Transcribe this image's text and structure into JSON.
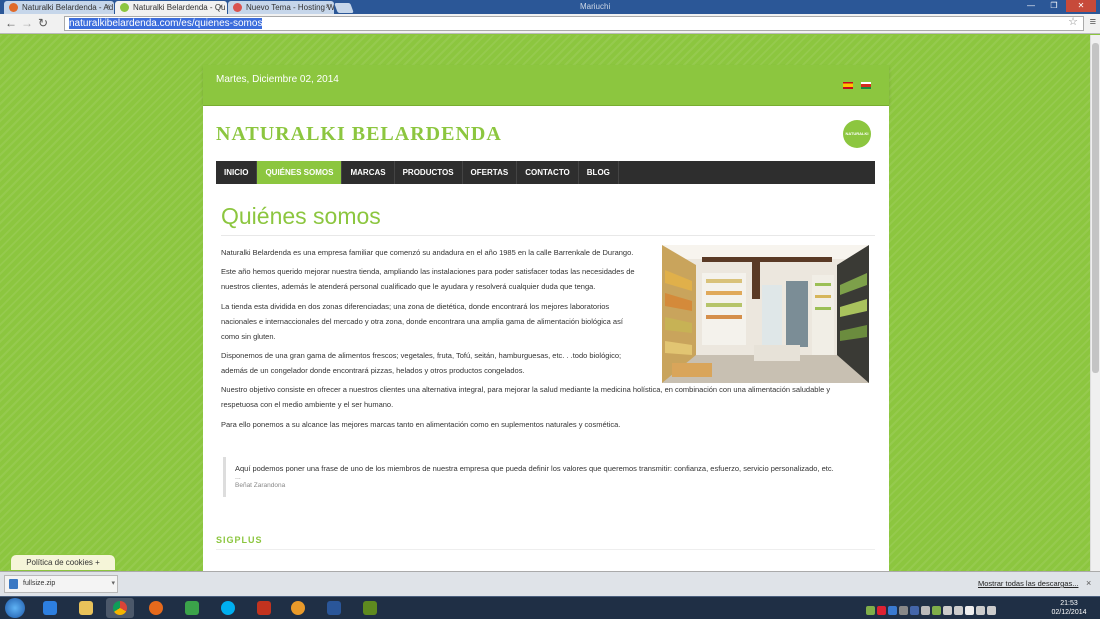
{
  "browser": {
    "tabs": [
      {
        "label": "Naturalki Belardenda - Ad",
        "active": false,
        "color": "#e06b2a"
      },
      {
        "label": "Naturalki Belardenda - Qu",
        "active": true,
        "color": "#8cc63f"
      },
      {
        "label": "Nuevo Tema - Hosting W",
        "active": false,
        "color": "#d9534f"
      }
    ],
    "user": "Mariuchi",
    "url": "naturalkibelardenda.com/es/quienes-somos"
  },
  "site": {
    "date": "Martes, Diciembre 02, 2014",
    "logo": "NATURALKI BELARDENDA",
    "badge": "NATURALKI",
    "nav": [
      {
        "label": "INICIO",
        "active": false
      },
      {
        "label": "QUIÉNES SOMOS",
        "active": true
      },
      {
        "label": "MARCAS",
        "active": false
      },
      {
        "label": "PRODUCTOS",
        "active": false
      },
      {
        "label": "OFERTAS",
        "active": false
      },
      {
        "label": "CONTACTO",
        "active": false
      },
      {
        "label": "BLOG",
        "active": false
      }
    ],
    "title": "Quiénes somos",
    "paragraphs": {
      "p1": "Naturalki Belardenda es una empresa familiar que comenzó su andadura  en el año 1985 en la calle Barrenkale de Durango.",
      "p2a": "Este año hemos querido mejorar nuestra tienda, ampliando las instalaciones para poder satisfacer todas las necesidades de",
      "p2b": "nuestros clientes, además le atenderá personal cualificado que le ayudara y resolverá cualquier duda que tenga.",
      "p3a": "La tienda esta dividida en dos zonas diferenciadas; una zona de dietética, donde encontrará los mejores laboratorios",
      "p3b": "nacionales e internaccionales del mercado y otra  zona, donde encontrara una amplia gama de alimentación biológica así",
      "p3c": " como sin gluten.",
      "p4a": "Disponemos de una gran gama de alimentos frescos; vegetales, fruta, Tofú, seitán, hamburguesas, etc. . .todo biológico;",
      "p4b": "además de un congelador donde encontrará pizzas, helados y otros productos congelados.",
      "p5a": "Nuestro objetivo consiste en ofrecer a nuestros clientes una alternativa integral, para mejorar la salud mediante la medicina holística, en combinación con una alimentación saludable y",
      "p5b": "respetuosa con el medio ambiente y el ser humano.",
      "p6": "Para ello ponemos a su alcance las mejores marcas tanto en alimentación como en suplementos naturales y cosmética."
    },
    "quote": {
      "text": "Aquí podemos poner una frase de uno de los miembros de nuestra empresa que pueda definir los valores que queremos transmitir: confianza, esfuerzo, servicio personalizado, etc.",
      "dots": "...",
      "author": "Beñat Zarandona"
    },
    "section_heading": "SIGPLUS",
    "cookies_label": "Política de cookies +"
  },
  "downloads": {
    "file": "fullsize.zip",
    "show_all": "Mostrar todas las descargas..."
  },
  "taskbar": {
    "time": "21:53",
    "date": "02/12/2014"
  }
}
